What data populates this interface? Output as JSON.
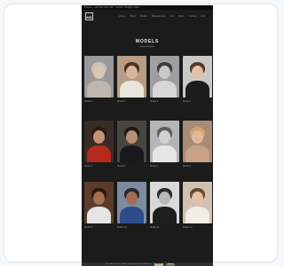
{
  "topbar": {
    "text": "Phone: +44 000 000 000 · Email: info@models"
  },
  "logo": {
    "text": "MD"
  },
  "nav": [
    "Home",
    "About",
    "Models",
    "Management",
    "Join",
    "News",
    "Contact",
    "Cart"
  ],
  "page": {
    "title": "MODELS"
  },
  "models": [
    {
      "name": "Model 1",
      "photo": {
        "bg": "#9a9a9a",
        "hair": "#c9c2b6",
        "face": "#d9c7b5",
        "body": "#bfb6ad"
      }
    },
    {
      "name": "Model 2",
      "photo": {
        "bg": "#b89c83",
        "hair": "#4a3424",
        "face": "#d8b79c",
        "body": "#e9e4dc"
      }
    },
    {
      "name": "Model 3",
      "photo": {
        "bg": "#9f9f9f",
        "hair": "#3b3b3b",
        "face": "#c8c8c8",
        "body": "#d7d7d7"
      }
    },
    {
      "name": "Model 4",
      "photo": {
        "bg": "#c9c9c9",
        "hair": "#5a3b2a",
        "face": "#e2c1a6",
        "body": "#1c1c1c"
      }
    },
    {
      "name": "Model 5",
      "photo": {
        "bg": "#3a2c25",
        "hair": "#2a1a12",
        "face": "#c79374",
        "body": "#b52a1f"
      }
    },
    {
      "name": "Model 6",
      "photo": {
        "bg": "#4b4540",
        "hair": "#1f1a17",
        "face": "#b98f76",
        "body": "#17191e"
      }
    },
    {
      "name": "Model 7",
      "photo": {
        "bg": "#b5b5b5",
        "hair": "#5e5e5e",
        "face": "#d2d2d2",
        "body": "#e5e5e5"
      }
    },
    {
      "name": "Model 8",
      "photo": {
        "bg": "#a88b74",
        "hair": "#cfa274",
        "face": "#e0b99b",
        "body": "#c9a184"
      }
    },
    {
      "name": "Model 9",
      "photo": {
        "bg": "#5b3b2b",
        "hair": "#2b1a12",
        "face": "#a36e52",
        "body": "#e4e4e4"
      }
    },
    {
      "name": "Model 10",
      "photo": {
        "bg": "#7e8aa0",
        "hair": "#2a2a2a",
        "face": "#a06c54",
        "body": "#2d4c8a"
      }
    },
    {
      "name": "Model 11",
      "photo": {
        "bg": "#d9d9d9",
        "hair": "#2a2a2a",
        "face": "#b8b8b8",
        "body": "#1e1e1e"
      }
    },
    {
      "name": "Model 12",
      "photo": {
        "bg": "#d0c2b2",
        "hair": "#6b4a34",
        "face": "#e2c1a5",
        "body": "#f1ece6"
      }
    }
  ],
  "cookie": {
    "text": "This website uses cookies to improve your experience.",
    "accept": "Accept",
    "reject": "Reject"
  }
}
